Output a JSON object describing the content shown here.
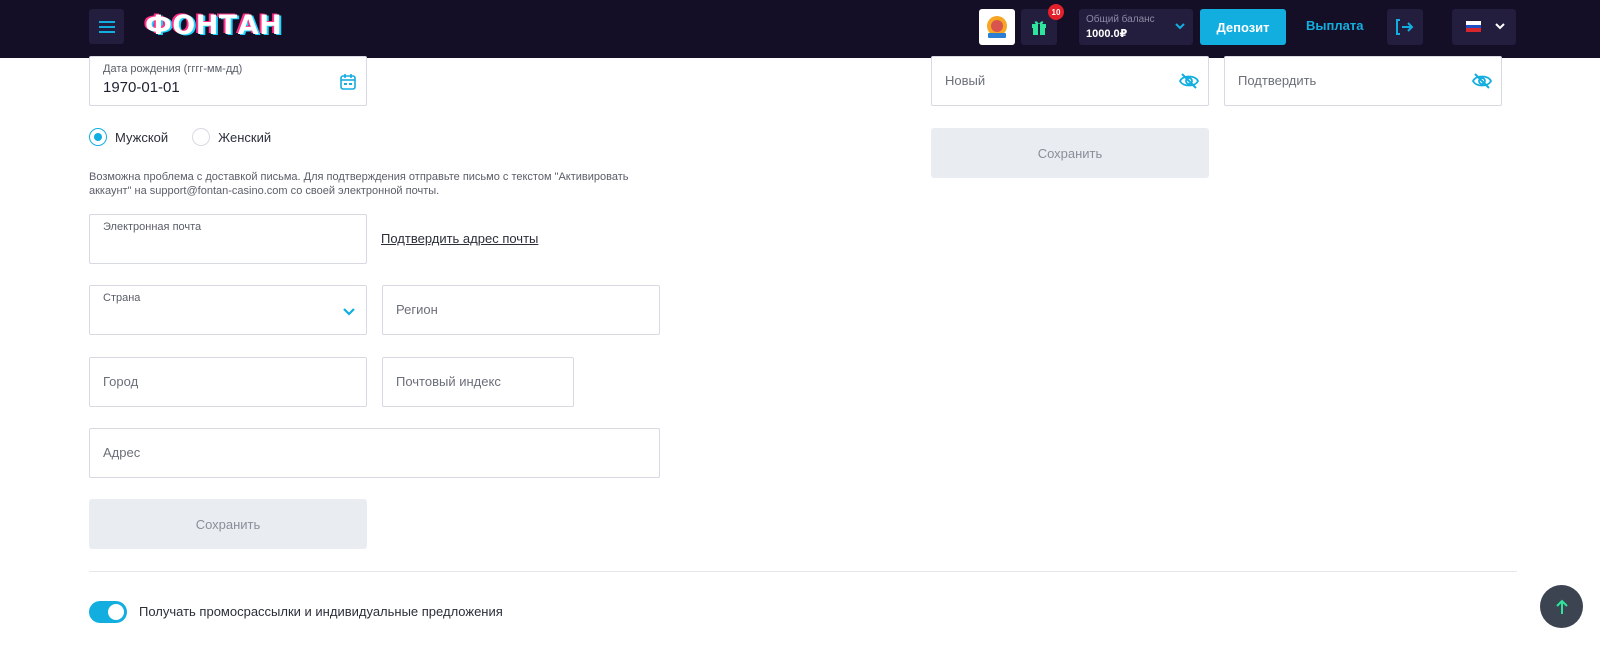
{
  "header": {
    "logo_text": "ФОНТАН",
    "gift_count": "10",
    "balance_label": "Общий баланс",
    "balance_value": "1000.0₽",
    "deposit_label": "Депозит",
    "withdraw_label": "Выплата",
    "language": "RU"
  },
  "personal": {
    "birthdate_label": "Дата рождения (гггг-мм-дд)",
    "birthdate_value": "1970-01-01",
    "gender_options": [
      "Мужской",
      "Женский"
    ],
    "gender_selected": "Мужской",
    "notice": "Возможна проблема с доставкой письма. Для подтверждения отправьте письмо с текстом \"Активировать аккаунт\" на support@fontan-casino.com со своей электронной почты.",
    "email_label": "Электронная почта",
    "confirm_email_link": "Подтвердить адрес почты",
    "country_label": "Страна",
    "region_placeholder": "Регион",
    "city_placeholder": "Город",
    "postal_placeholder": "Почтовый индекс",
    "address_placeholder": "Адрес",
    "save_label": "Сохранить"
  },
  "password": {
    "new_placeholder": "Новый",
    "confirm_placeholder": "Подтвердить",
    "save_label": "Сохранить"
  },
  "promo": {
    "toggle_label": "Получать промосрассылки и индивидуальные предложения",
    "enabled": true
  },
  "colors": {
    "header_bg": "#140f26",
    "accent": "#13aee0",
    "button_disabled_bg": "#e9ecf1"
  }
}
